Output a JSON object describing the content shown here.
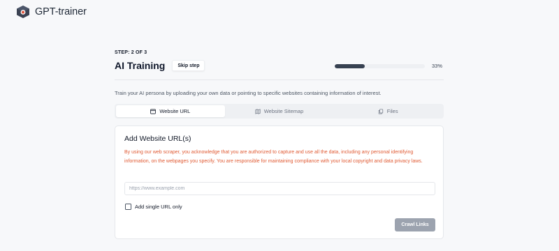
{
  "app": {
    "name": "GPT-trainer"
  },
  "header": {
    "step_label": "STEP: 2 OF 3",
    "title": "AI Training",
    "skip_label": "Skip step",
    "progress_percent": 33,
    "progress_text": "33%"
  },
  "description": "Train your AI persona by uploading your own data or pointing to specific websites containing information of interest.",
  "tabs": [
    {
      "label": "Website URL",
      "icon": "browser-window-icon",
      "active": true
    },
    {
      "label": "Website Sitemap",
      "icon": "sitemap-icon",
      "active": false
    },
    {
      "label": "Files",
      "icon": "files-icon",
      "active": false
    }
  ],
  "card": {
    "title": "Add Website URL(s)",
    "warning": "By using our web scraper, you acknowledge that you are authorized to capture and use all the data, including any personal identifying information, on the webpages you specify. You are responsible for maintaining compliance with your local copyright and data privacy laws.",
    "url_placeholder": "https://www.example.com",
    "url_value": "",
    "checkbox_label": "Add single URL only",
    "checkbox_checked": false,
    "crawl_label": "Crawl Links"
  },
  "colors": {
    "accent": "#374151",
    "warning": "#e05a33",
    "button_disabled": "#9ca3af",
    "background": "#f7f8fa"
  }
}
